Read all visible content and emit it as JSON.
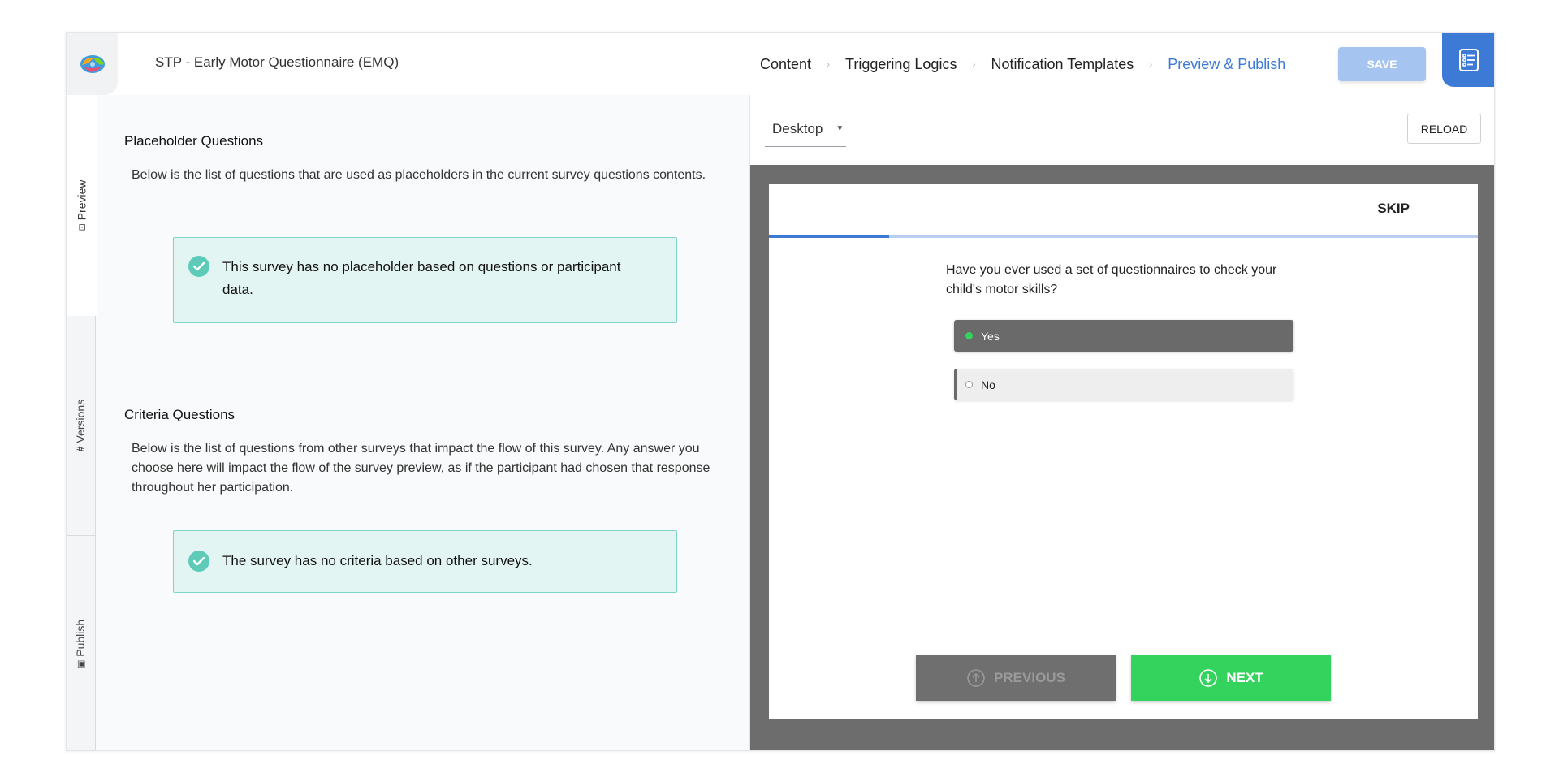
{
  "header": {
    "app_title": "STP - Early Motor Questionnaire (EMQ)",
    "nav": [
      {
        "label": "Content",
        "active": false
      },
      {
        "label": "Triggering Logics",
        "active": false
      },
      {
        "label": "Notification Templates",
        "active": false
      },
      {
        "label": "Preview & Publish",
        "active": true
      }
    ],
    "save_label": "SAVE",
    "icons": {
      "logo": "brain-logo-icon",
      "doc": "survey-list-icon",
      "sep": "chevron-right-icon"
    }
  },
  "vtabs": [
    {
      "label": "Preview",
      "icon": "preview-icon",
      "glyph": "⊡",
      "active": true
    },
    {
      "label": "Versions",
      "icon": "hash-icon",
      "glyph": "#",
      "active": false
    },
    {
      "label": "Publish",
      "icon": "publish-icon",
      "glyph": "▣",
      "active": false
    }
  ],
  "placeholder": {
    "title": "Placeholder Questions",
    "description": "Below is the list of questions that are used as placeholders in the current survey questions contents.",
    "message": "This survey has no placeholder based on questions or participant data."
  },
  "criteria": {
    "title": "Criteria Questions",
    "description": "Below is the list of questions from other surveys that impact the flow of this survey. Any answer you choose here will impact the flow of the survey preview, as if the participant had chosen that response throughout her participation.",
    "message": "The survey has no criteria based on other surveys."
  },
  "preview": {
    "device": "Desktop",
    "reload_label": "RELOAD",
    "skip_label": "SKIP",
    "progress": 0.17,
    "question": "Have you ever used a set of questionnaires to check your child's motor skills?",
    "options": [
      {
        "label": "Yes",
        "selected": true
      },
      {
        "label": "No",
        "selected": false
      }
    ],
    "previous_label": "PREVIOUS",
    "next_label": "NEXT"
  },
  "colors": {
    "accent": "#3d7ad6",
    "success_bg": "#e3f5f2",
    "success_border": "#7cd6c8",
    "next_green": "#33d35e"
  }
}
